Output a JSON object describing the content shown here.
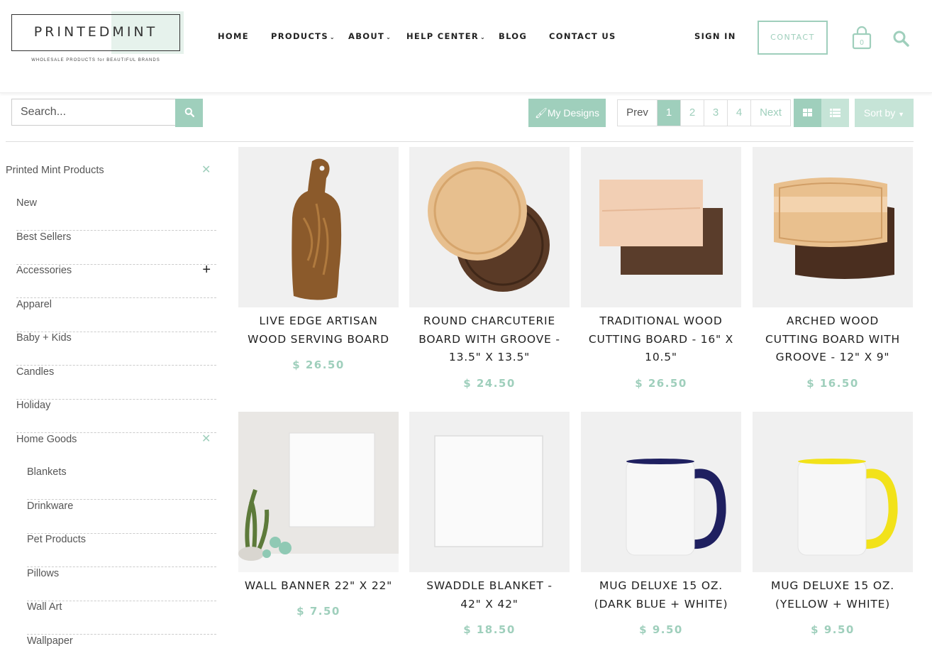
{
  "header": {
    "logo_text": "PRINTEDMINT",
    "logo_tagline": "WHOLESALE PRODUCTS for BEAUTIFUL BRANDS",
    "nav": [
      {
        "label": "HOME",
        "caret": false
      },
      {
        "label": "PRODUCTS",
        "caret": true
      },
      {
        "label": "ABOUT",
        "caret": true
      },
      {
        "label": "HELP CENTER",
        "caret": true
      },
      {
        "label": "BLOG",
        "caret": false
      },
      {
        "label": "CONTACT US",
        "caret": false
      }
    ],
    "signin": "SIGN IN",
    "contact_button": "CONTACT",
    "cart_count": "0",
    "icons": {
      "cart": "shopping-bag-icon",
      "search": "search-icon"
    }
  },
  "toolbar": {
    "search_placeholder": "Search...",
    "my_designs": "My Designs",
    "pager": {
      "prev": "Prev",
      "pages": [
        "1",
        "2",
        "3",
        "4"
      ],
      "active": "1",
      "next": "Next"
    },
    "sort_by": "Sort by"
  },
  "sidebar": {
    "root": "Printed Mint Products",
    "items": [
      {
        "label": "New"
      },
      {
        "label": "Best Sellers"
      },
      {
        "label": "Accessories"
      },
      {
        "label": "Apparel"
      },
      {
        "label": "Baby + Kids"
      },
      {
        "label": "Candles"
      },
      {
        "label": "Holiday"
      },
      {
        "label": "Home Goods"
      }
    ],
    "sub_items": [
      {
        "label": "Blankets"
      },
      {
        "label": "Drinkware"
      },
      {
        "label": "Pet Products"
      },
      {
        "label": "Pillows"
      },
      {
        "label": "Wall Art"
      },
      {
        "label": "Wallpaper"
      }
    ]
  },
  "products": [
    {
      "title_lines": [
        "LIVE EDGE ARTISAN",
        "WOOD SERVING BOARD"
      ],
      "price": "$ 26.50"
    },
    {
      "title_lines": [
        "ROUND CHARCUTERIE",
        "BOARD WITH GROOVE -",
        "13.5\" X 13.5\""
      ],
      "price": "$ 24.50"
    },
    {
      "title_lines": [
        "TRADITIONAL WOOD",
        "CUTTING BOARD - 16\" X",
        "10.5\""
      ],
      "price": "$ 26.50"
    },
    {
      "title_lines": [
        "ARCHED WOOD",
        "CUTTING BOARD WITH",
        "GROOVE - 12\" X 9\""
      ],
      "price": "$ 16.50"
    },
    {
      "title_lines": [
        "WALL BANNER 22\" X 22\""
      ],
      "price": "$ 7.50"
    },
    {
      "title_lines": [
        "SWADDLE BLANKET -",
        "42\" X 42\""
      ],
      "price": "$ 18.50"
    },
    {
      "title_lines": [
        "MUG DELUXE 15 OZ.",
        "(DARK BLUE + WHITE)"
      ],
      "price": "$ 9.50"
    },
    {
      "title_lines": [
        "MUG DELUXE 15 OZ.",
        "(YELLOW + WHITE)"
      ],
      "price": "$ 9.50"
    }
  ],
  "colors": {
    "accent": "#9fcfbc",
    "accent_light": "#c6e4d7",
    "text": "#222222"
  }
}
